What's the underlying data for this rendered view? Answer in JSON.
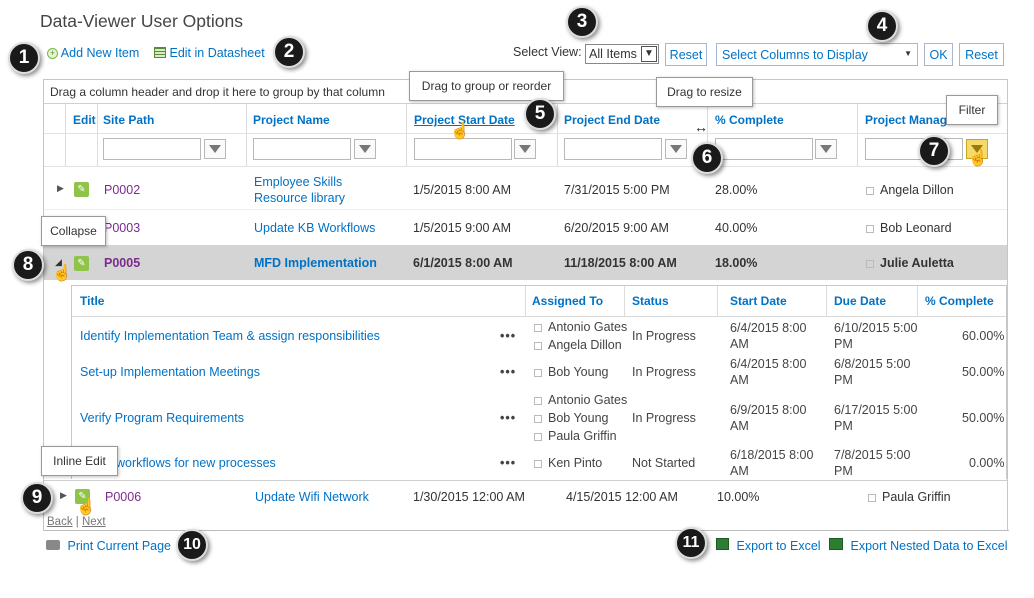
{
  "page_title": "Data-Viewer User Options",
  "toolbar": {
    "add_new": "Add New Item",
    "edit_datasheet": "Edit in Datasheet",
    "select_view_label": "Select View:",
    "view_value": "All Items",
    "reset": "Reset",
    "columns_value": "Select Columns to Display",
    "ok": "OK",
    "reset2": "Reset"
  },
  "group_hint": "Drag a column header and drop it here to group by that column",
  "tooltips": {
    "group_reorder": "Drag to group or reorder",
    "resize": "Drag to resize",
    "filter": "Filter",
    "collapse": "Collapse",
    "inline_edit": "Inline Edit"
  },
  "numbers": [
    "1",
    "2",
    "3",
    "4",
    "5",
    "6",
    "7",
    "8",
    "9",
    "10",
    "11"
  ],
  "columns": {
    "edit": "Edit",
    "site_path": "Site Path",
    "project_name": "Project Name",
    "start": "Project Start Date",
    "end": "Project End Date",
    "pct": "% Complete",
    "manager": "Project Manag"
  },
  "rows": [
    {
      "site": "P0002",
      "name1": "Employee Skills",
      "name2": "Resource library",
      "start": "1/5/2015 8:00 AM",
      "end": "7/31/2015 5:00 PM",
      "pct": "28.00%",
      "manager": "Angela Dillon"
    },
    {
      "site": "P0003",
      "name1": "Update KB Workflows",
      "start": "1/5/2015 9:00 AM",
      "end": "6/20/2015 9:00 AM",
      "pct": "40.00%",
      "manager": "Bob Leonard"
    },
    {
      "site": "P0005",
      "name1": "MFD Implementation",
      "start": "6/1/2015 8:00 AM",
      "end": "11/18/2015 8:00 AM",
      "pct": "18.00%",
      "manager": "Julie Auletta"
    },
    {
      "site": "P0006",
      "name1": "Update Wifi Network",
      "start": "1/30/2015 12:00 AM",
      "end": "4/15/2015 12:00 AM",
      "pct": "10.00%",
      "manager": "Paula Griffin"
    }
  ],
  "nested_columns": {
    "title": "Title",
    "assigned": "Assigned To",
    "status": "Status",
    "start": "Start Date",
    "due": "Due Date",
    "pct": "% Complete"
  },
  "nested_rows": [
    {
      "title": "Identify Implementation Team & assign responsibilities",
      "assigned": [
        "Antonio Gates",
        "Angela Dillon"
      ],
      "status": "In Progress",
      "start1": "6/4/2015 8:00",
      "start2": "AM",
      "due1": "6/10/2015 5:00",
      "due2": "PM",
      "pct": "60.00%"
    },
    {
      "title": "Set-up Implementation Meetings",
      "assigned": [
        "Bob Young"
      ],
      "status": "In Progress",
      "start1": "6/4/2015 8:00",
      "start2": "AM",
      "due1": "6/8/2015 5:00",
      "due2": "PM",
      "pct": "50.00%"
    },
    {
      "title": "Verify Program Requirements",
      "assigned": [
        "Antonio Gates",
        "Bob Young",
        "Paula Griffin"
      ],
      "status": "In Progress",
      "start1": "6/9/2015 8:00",
      "start2": "AM",
      "due1": "6/17/2015 5:00",
      "due2": "PM",
      "pct": "50.00%"
    },
    {
      "title": "workflows for new processes",
      "assigned": [
        "Ken Pinto"
      ],
      "status": "Not Started",
      "start1": "6/18/2015 8:00",
      "start2": "AM",
      "due1": "7/8/2015 5:00",
      "due2": "PM",
      "pct": "0.00%"
    }
  ],
  "nested_more": "•••",
  "pager": {
    "back": "Back",
    "sep": "|",
    "next": "Next"
  },
  "footer": {
    "print": "Print Current Page",
    "export": "Export to Excel",
    "export_nested": "Export Nested Data to Excel"
  },
  "colors": {
    "link": "#0072c6",
    "purple": "#7a2b8f",
    "selected_row": "#d4d4d4",
    "pen": "#8fc34a"
  }
}
